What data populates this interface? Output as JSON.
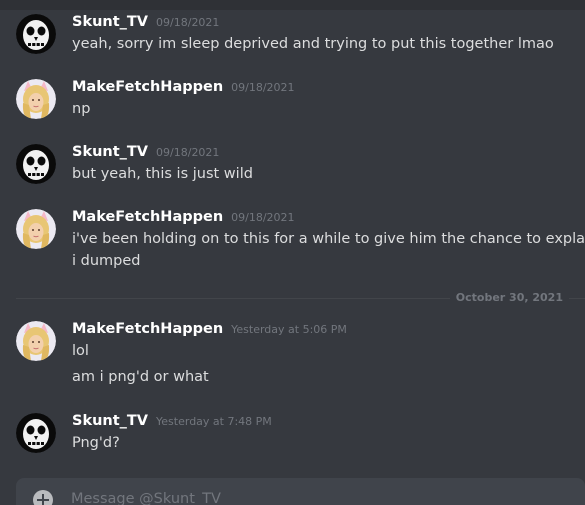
{
  "messages": [
    {
      "author": "Skunt_TV",
      "timestamp": "09/18/2021",
      "lines": [
        "yeah, sorry im sleep deprived and trying to put this together lmao"
      ],
      "avatar_icon": "skull-mask-avatar-icon"
    },
    {
      "author": "MakeFetchHappen",
      "timestamp": "09/18/2021",
      "lines": [
        "np"
      ],
      "avatar_icon": "cat-ears-portrait-avatar-icon"
    },
    {
      "author": "Skunt_TV",
      "timestamp": "09/18/2021",
      "lines": [
        "but yeah, this is just wild"
      ],
      "avatar_icon": "skull-mask-avatar-icon"
    },
    {
      "author": "MakeFetchHappen",
      "timestamp": "09/18/2021",
      "lines": [
        "i've been holding on to this for a while to give him the chance to explain himse",
        "i dumped"
      ],
      "avatar_icon": "cat-ears-portrait-avatar-icon"
    },
    {
      "author": "MakeFetchHappen",
      "timestamp": "Yesterday at 5:06 PM",
      "lines": [
        "lol",
        "am i png'd or what"
      ],
      "avatar_icon": "cat-ears-portrait-avatar-icon"
    },
    {
      "author": "Skunt_TV",
      "timestamp": "Yesterday at 7:48 PM",
      "lines": [
        "Png'd?"
      ],
      "avatar_icon": "skull-mask-avatar-icon"
    }
  ],
  "date_divider": "October 30, 2021",
  "composer": {
    "placeholder": "Message @Skunt_TV",
    "add_icon": "plus-circle-icon"
  },
  "colors": {
    "background": "#36393f",
    "author": "#ffffff",
    "text": "#dcddde",
    "muted": "#72767d",
    "composer": "#40444b"
  }
}
